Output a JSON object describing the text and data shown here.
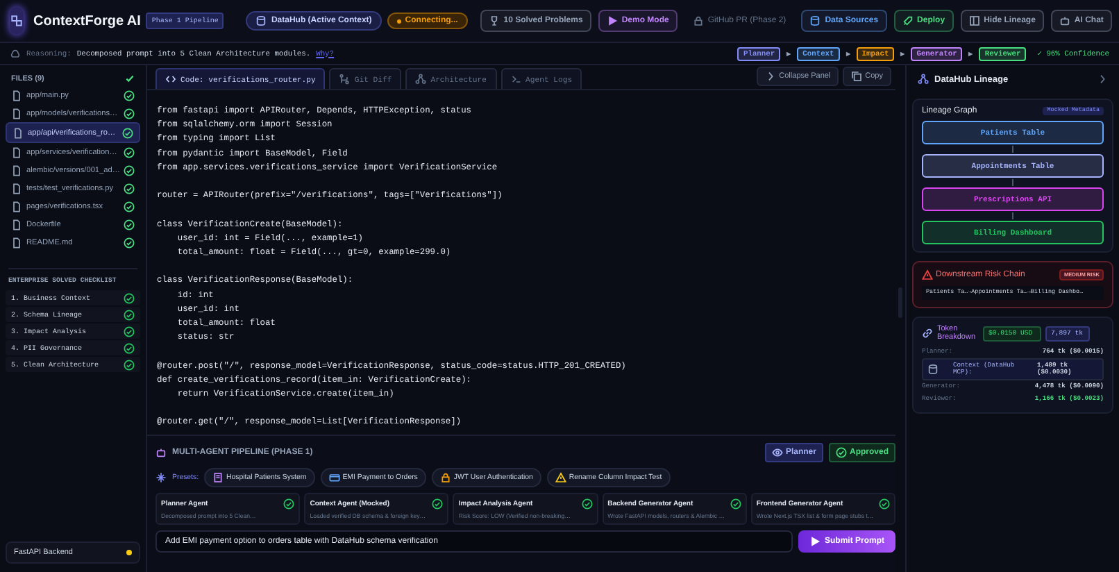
{
  "header": {
    "title": "ContextForge AI",
    "phase_badge": "Phase 1 Pipeline",
    "context_badge": "DataHub (Active Context)",
    "status": {
      "label": "Connecting...",
      "color": "#f59e0b"
    },
    "buttons": [
      {
        "label": "10 Solved Problems",
        "color": "#94a3b8",
        "disabled": false
      },
      {
        "label": "Demo Mode",
        "color": "#c084fc",
        "disabled": false
      },
      {
        "label": "GitHub PR (Phase 2)",
        "color": "#64748b",
        "disabled": true
      },
      {
        "label": "Data Sources",
        "color": "#60a5fa",
        "disabled": false
      },
      {
        "label": "Deploy",
        "color": "#4ade80",
        "disabled": false
      },
      {
        "label": "Hide Lineage",
        "color": "#94a3b8",
        "disabled": false
      },
      {
        "label": "AI Chat",
        "color": "#94a3b8",
        "disabled": false
      }
    ]
  },
  "reasoning": {
    "label": "Reasoning:",
    "text": "Decomposed prompt into 5 Clean Architecture modules.",
    "link": "Why?"
  },
  "pipeline_steps": [
    {
      "label": "Planner",
      "color": "#818cf8"
    },
    {
      "label": "Context",
      "color": "#60a5fa"
    },
    {
      "label": "Impact",
      "color": "#f59e0b"
    },
    {
      "label": "Generator",
      "color": "#c084fc"
    },
    {
      "label": "Reviewer",
      "color": "#4ade80"
    }
  ],
  "confidence": "✓ 96% Confidence",
  "sidebar": {
    "files_title": "FILES (9)",
    "files_done": true,
    "files": [
      {
        "name": "app/main.py",
        "selected": false,
        "done": true
      },
      {
        "name": "app/models/verifications…",
        "selected": false,
        "done": true
      },
      {
        "name": "app/api/verifications_ro…",
        "selected": true,
        "done": true
      },
      {
        "name": "app/services/verification…",
        "selected": false,
        "done": true
      },
      {
        "name": "alembic/versions/001_ad…",
        "selected": false,
        "done": true
      },
      {
        "name": "tests/test_verifications.py",
        "selected": false,
        "done": true
      },
      {
        "name": "pages/verifications.tsx",
        "selected": false,
        "done": true
      },
      {
        "name": "Dockerfile",
        "selected": false,
        "done": true
      },
      {
        "name": "README.md",
        "selected": false,
        "done": true
      }
    ],
    "checklist_title": "ENTERPRISE SOLVED CHECKLIST",
    "checklist": [
      {
        "label": "1. Business Context",
        "done": true
      },
      {
        "label": "2. Schema Lineage",
        "done": true
      },
      {
        "label": "3. Impact Analysis",
        "done": true
      },
      {
        "label": "4. PII Governance",
        "done": true
      },
      {
        "label": "5. Clean Architecture",
        "done": true
      }
    ],
    "backend": {
      "label": "FastAPI Backend",
      "color": "#facc15"
    }
  },
  "tabs": [
    {
      "label": "Code: verifications_router.py",
      "selected": true
    },
    {
      "label": "Git Diff",
      "selected": false
    },
    {
      "label": "Architecture",
      "selected": false
    },
    {
      "label": "Agent Logs",
      "selected": false
    }
  ],
  "code_actions": [
    "Collapse Panel",
    "Copy"
  ],
  "code": "from fastapi import APIRouter, Depends, HTTPException, status\nfrom sqlalchemy.orm import Session\nfrom typing import List\nfrom pydantic import BaseModel, Field\nfrom app.services.verifications_service import VerificationService\n\nrouter = APIRouter(prefix=\"/verifications\", tags=[\"Verifications\"])\n\nclass VerificationCreate(BaseModel):\n    user_id: int = Field(..., example=1)\n    total_amount: float = Field(..., gt=0, example=299.0)\n\nclass VerificationResponse(BaseModel):\n    id: int\n    user_id: int\n    total_amount: float\n    status: str\n\n@router.post(\"/\", response_model=VerificationResponse, status_code=status.HTTP_201_CREATED)\ndef create_verifications_record(item_in: VerificationCreate):\n    return VerificationService.create(item_in)\n\n@router.get(\"/\", response_model=List[VerificationResponse])",
  "pipeline": {
    "title": "MULTI-AGENT PIPELINE (PHASE 1)",
    "planner": "Planner",
    "approved": "Approved",
    "presets_label": "Presets:",
    "presets": [
      "Hospital Patients System",
      "EMI Payment to Orders",
      "JWT User Authentication",
      "Rename Column Impact Test"
    ],
    "agents": [
      {
        "name": "Planner Agent",
        "detail": "Decomposed prompt into 5 Clean…",
        "done": true
      },
      {
        "name": "Context Agent (Mocked)",
        "detail": "Loaded verified DB schema & foreign key…",
        "done": true
      },
      {
        "name": "Impact Analysis Agent",
        "detail": "Risk Score: LOW (Verified non-breaking…",
        "done": true
      },
      {
        "name": "Backend Generator Agent",
        "detail": "Wrote FastAPI models, routers & Alembic …",
        "done": true
      },
      {
        "name": "Frontend Generator Agent",
        "detail": "Wrote Next.js TSX list & form page stubs t…",
        "done": true
      }
    ],
    "prompt": "Add EMI payment option to orders table with DataHub schema verification",
    "submit": "Submit Prompt"
  },
  "lineage": {
    "title": "DataHub Lineage",
    "graph_title": "Lineage Graph",
    "graph_badge": "Mocked Metadata",
    "nodes": [
      {
        "label": "Patients Table",
        "color": "#60a5fa"
      },
      {
        "label": "Appointments Table",
        "color": "#a5b4fc"
      },
      {
        "label": "Prescriptions API",
        "color": "#d946ef"
      },
      {
        "label": "Billing Dashboard",
        "color": "#22c55e"
      }
    ],
    "risk": {
      "title": "Downstream Risk Chain",
      "badge": "MEDIUM RISK",
      "chain": "Patients Ta…→Appointments Ta…→Billing Dashbo…"
    },
    "tokens": {
      "title": "Token Breakdown",
      "cost": "$0.0150 USD",
      "total": "7,897 tk",
      "rows": [
        {
          "label": "Planner:",
          "value": "764 tk ($0.0015)",
          "selected": false
        },
        {
          "label": "Context (DataHub MCP):",
          "value": "1,489 tk ($0.0030)",
          "selected": true
        },
        {
          "label": "Generator:",
          "value": "4,478 tk ($0.0090)",
          "selected": false
        },
        {
          "label": "Reviewer:",
          "value": "1,166 tk ($0.0023)",
          "selected": false
        }
      ]
    }
  }
}
